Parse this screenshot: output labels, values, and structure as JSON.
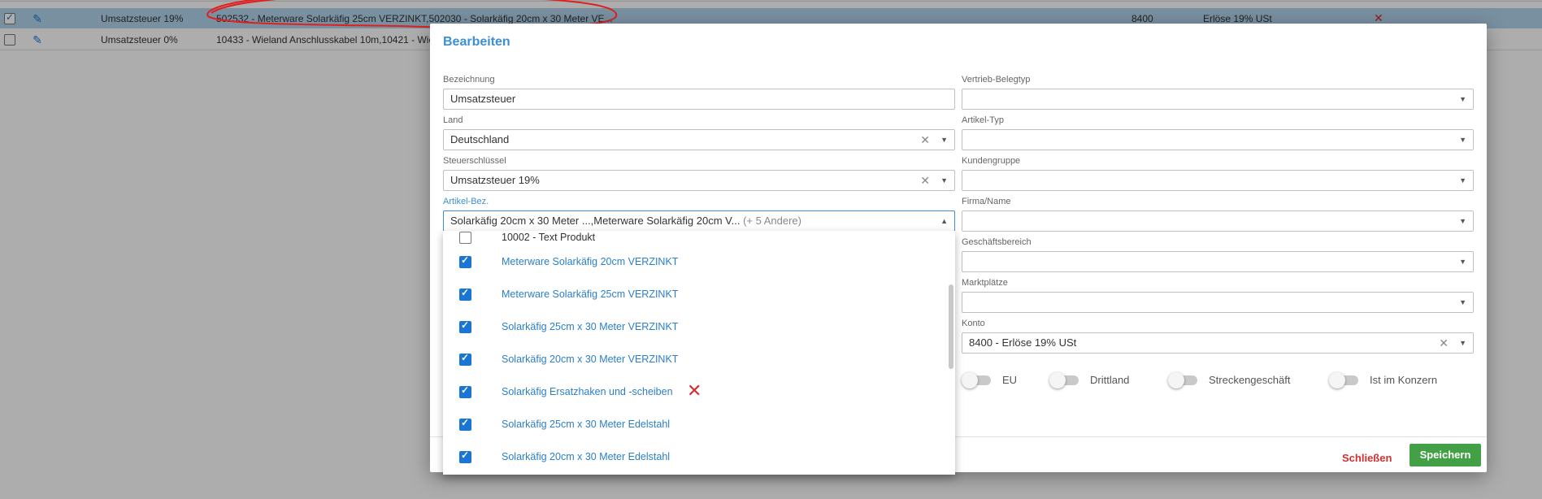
{
  "table": {
    "rows": [
      {
        "checked": true,
        "tax": "Umsatzsteuer 19%",
        "articles": "502532 - Meterware Solarkäfig 25cm VERZINKT,502030 - Solarkäfig 20cm x 30 Meter VE...",
        "konto": "8400",
        "revenue": "Erlöse 19% USt",
        "delete": "✕"
      },
      {
        "checked": false,
        "tax": "Umsatzsteuer 0%",
        "articles": "10433 - Wieland Anschlusskabel 10m,10421 - Wie",
        "konto": "",
        "revenue": "",
        "delete": ""
      }
    ]
  },
  "dialog": {
    "title": "Bearbeiten",
    "bezeichnung": {
      "label": "Bezeichnung",
      "value": "Umsatzsteuer"
    },
    "land": {
      "label": "Land",
      "value": "Deutschland"
    },
    "steuerschluessel": {
      "label": "Steuerschlüssel",
      "value": "Umsatzsteuer 19%"
    },
    "artikel_bez": {
      "label": "Artikel-Bez.",
      "value": "Solarkäfig 20cm x 30 Meter ...,Meterware Solarkäfig 20cm V...",
      "extra": "(+ 5 Andere)"
    },
    "vertrieb_belegtyp": {
      "label": "Vertrieb-Belegtyp",
      "value": ""
    },
    "artikel_typ": {
      "label": "Artikel-Typ",
      "value": ""
    },
    "kundengruppe": {
      "label": "Kundengruppe",
      "value": ""
    },
    "firma_name": {
      "label": "Firma/Name",
      "value": ""
    },
    "geschaeftsbereich": {
      "label": "Geschäftsbereich",
      "value": ""
    },
    "marktplaetze": {
      "label": "Marktplätze",
      "value": ""
    },
    "konto": {
      "label": "Konto",
      "value": "8400 - Erlöse 19% USt"
    },
    "toggles": [
      {
        "label": "EU",
        "on": false
      },
      {
        "label": "Drittland",
        "on": false
      },
      {
        "label": "Streckengeschäft",
        "on": false
      },
      {
        "label": "Ist im Konzern",
        "on": false
      }
    ],
    "close_label": "Schließen",
    "save_label": "Speichern"
  },
  "dropdown": {
    "items": [
      {
        "label": "10002 - Text Produkt",
        "checked": false
      },
      {
        "label": "Meterware Solarkäfig 20cm VERZINKT",
        "checked": true
      },
      {
        "label": "Meterware Solarkäfig 25cm VERZINKT",
        "checked": true
      },
      {
        "label": "Solarkäfig 25cm x 30 Meter VERZINKT",
        "checked": true
      },
      {
        "label": "Solarkäfig 20cm x 30 Meter VERZINKT",
        "checked": true
      },
      {
        "label": "Solarkäfig Ersatzhaken und -scheiben",
        "checked": true,
        "annotation": "✕"
      },
      {
        "label": "Solarkäfig 25cm x 30 Meter Edelstahl",
        "checked": true
      },
      {
        "label": "Solarkäfig 20cm x 30 Meter Edelstahl",
        "checked": true
      }
    ]
  },
  "colors": {
    "accent": "#3d8fd4",
    "save": "#43a047",
    "close": "#d32f2f",
    "annotation": "#d32f2f"
  },
  "icons": {
    "edit": "pencil-icon",
    "clear": "close-icon",
    "dropdown": "caret-down-icon",
    "checkbox": "checkbox-icon"
  }
}
